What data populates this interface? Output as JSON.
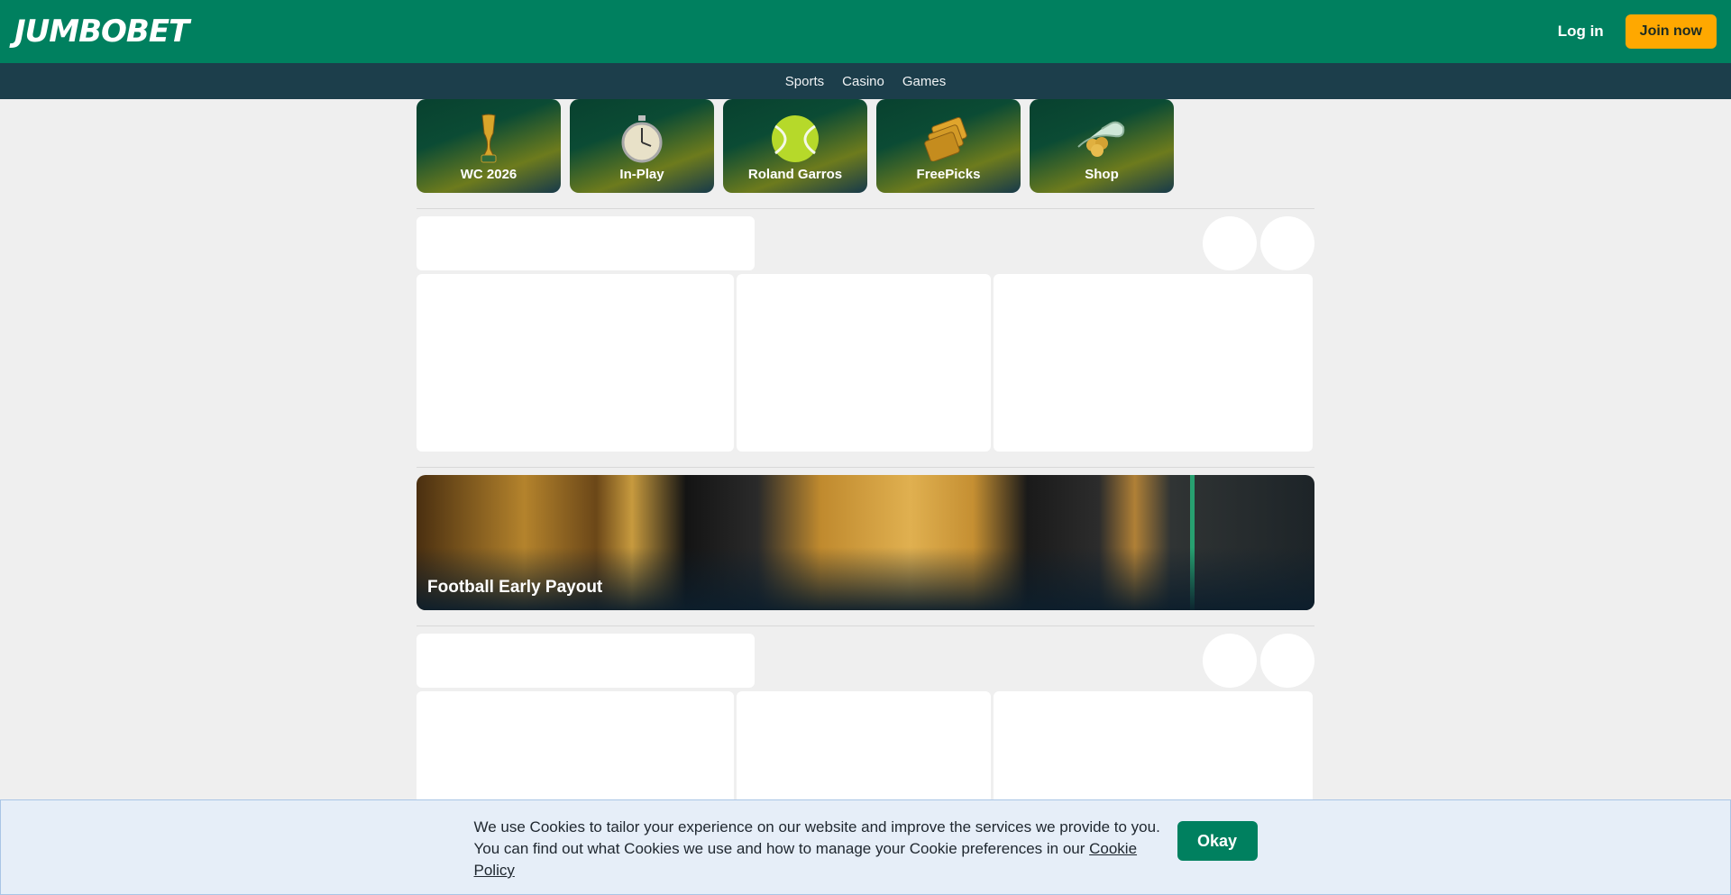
{
  "header": {
    "logo": "JUMBOBET",
    "login_label": "Log in",
    "join_label": "Join now"
  },
  "subnav": {
    "items": [
      {
        "label": "Sports"
      },
      {
        "label": "Casino"
      },
      {
        "label": "Games"
      }
    ]
  },
  "quick_links": [
    {
      "label": "WC 2026",
      "icon": "trophy-icon"
    },
    {
      "label": "In-Play",
      "icon": "stopwatch-icon"
    },
    {
      "label": "Roland Garros",
      "icon": "tennis-ball-icon"
    },
    {
      "label": "FreePicks",
      "icon": "cards-icon"
    },
    {
      "label": "Shop",
      "icon": "coins-hand-icon"
    }
  ],
  "banner": {
    "title": "Football Early Payout"
  },
  "cookie": {
    "line1": "We use Cookies to tailor your experience on our website and improve the services we provide to you.",
    "line2": "You can find out what Cookies we use and how to manage your Cookie preferences in our ",
    "link_label": "Cookie Policy",
    "line3": ".",
    "okay_label": "Okay"
  },
  "colors": {
    "brand_green": "#00805f",
    "nav_dark": "#1c3e4b",
    "join_orange": "#ffa800",
    "cookie_bg": "#e6eef8"
  }
}
